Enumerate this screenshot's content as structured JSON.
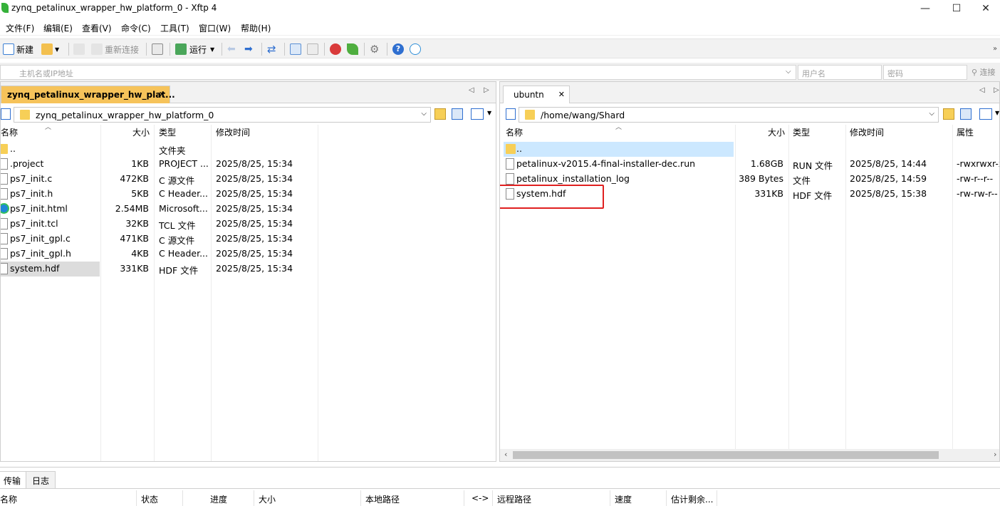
{
  "window": {
    "title": "zynq_petalinux_wrapper_hw_platform_0 - Xftp 4",
    "minimize": "—",
    "maximize": "☐",
    "close": "✕"
  },
  "menu": [
    "文件(F)",
    "编辑(E)",
    "查看(V)",
    "命令(C)",
    "工具(T)",
    "窗口(W)",
    "帮助(H)"
  ],
  "toolbar": {
    "new_label": "新建",
    "reconnect_label": "重新连接",
    "run_label": "运行"
  },
  "address": {
    "host_placeholder": "主机名或IP地址",
    "user_placeholder": "用户名",
    "password_placeholder": "密码",
    "connect_label": "连接"
  },
  "left": {
    "tab_label": "zynq_petalinux_wrapper_hw_plat...",
    "path": "zynq_petalinux_wrapper_hw_platform_0",
    "columns": {
      "name": "名称",
      "size": "大小",
      "type": "类型",
      "mtime": "修改时间"
    },
    "files": [
      {
        "name": "..",
        "size": "",
        "type": "文件夹",
        "mtime": ""
      },
      {
        "name": ".project",
        "size": "1KB",
        "type": "PROJECT ...",
        "mtime": "2025/8/25, 15:34"
      },
      {
        "name": "ps7_init.c",
        "size": "472KB",
        "type": "C 源文件",
        "mtime": "2025/8/25, 15:34"
      },
      {
        "name": "ps7_init.h",
        "size": "5KB",
        "type": "C Header...",
        "mtime": "2025/8/25, 15:34"
      },
      {
        "name": "ps7_init.html",
        "size": "2.54MB",
        "type": "Microsoft...",
        "mtime": "2025/8/25, 15:34"
      },
      {
        "name": "ps7_init.tcl",
        "size": "32KB",
        "type": "TCL 文件",
        "mtime": "2025/8/25, 15:34"
      },
      {
        "name": "ps7_init_gpl.c",
        "size": "471KB",
        "type": "C 源文件",
        "mtime": "2025/8/25, 15:34"
      },
      {
        "name": "ps7_init_gpl.h",
        "size": "4KB",
        "type": "C Header...",
        "mtime": "2025/8/25, 15:34"
      },
      {
        "name": "system.hdf",
        "size": "331KB",
        "type": "HDF 文件",
        "mtime": "2025/8/25, 15:34"
      }
    ]
  },
  "right": {
    "tab_label": "ubuntn",
    "path": "/home/wang/Shard",
    "columns": {
      "name": "名称",
      "size": "大小",
      "type": "类型",
      "mtime": "修改时间",
      "attr": "属性"
    },
    "files": [
      {
        "name": "..",
        "size": "",
        "type": "",
        "mtime": "",
        "attr": ""
      },
      {
        "name": "petalinux-v2015.4-final-installer-dec.run",
        "size": "1.68GB",
        "type": "RUN 文件",
        "mtime": "2025/8/25, 14:44",
        "attr": "-rwxrwxr-x"
      },
      {
        "name": "petalinux_installation_log",
        "size": "389 Bytes",
        "type": "文件",
        "mtime": "2025/8/25, 14:59",
        "attr": "-rw-r--r--"
      },
      {
        "name": "system.hdf",
        "size": "331KB",
        "type": "HDF 文件",
        "mtime": "2025/8/25, 15:38",
        "attr": "-rw-rw-r--"
      }
    ]
  },
  "bottom": {
    "tabs": [
      "传输",
      "日志"
    ],
    "columns": [
      "名称",
      "状态",
      "进度",
      "大小",
      "本地路径",
      "<->",
      "远程路径",
      "速度",
      "估计剩余..."
    ]
  },
  "colors": {
    "active_tab": "#f6c35a",
    "selection": "#dcdcdc",
    "highlight_row": "#cce8ff",
    "annotation_box": "#e02020",
    "folder": "#f7cf57"
  }
}
